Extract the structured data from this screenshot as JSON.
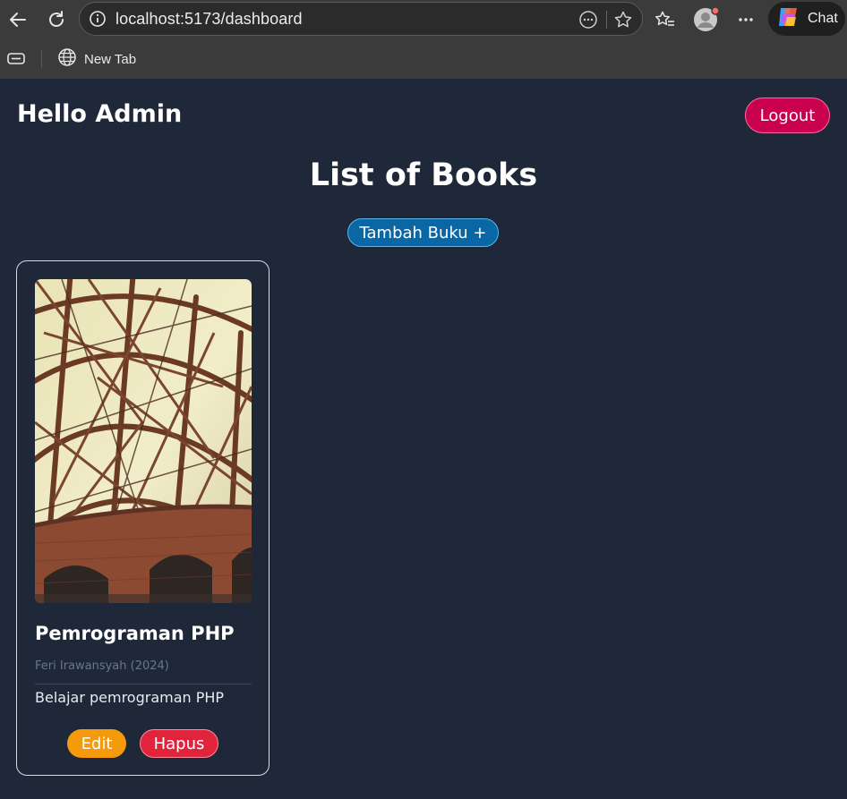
{
  "browser": {
    "url": "localhost:5173/dashboard",
    "chat_label": "Chat",
    "bookmarks": [
      {
        "label": "New Tab"
      }
    ]
  },
  "header": {
    "greeting": "Hello Admin",
    "logout_label": "Logout"
  },
  "main": {
    "title": "List of Books",
    "add_button_label": "Tambah Buku +",
    "books": [
      {
        "title": "Pemrograman PHP",
        "meta": "Feri Irawansyah (2024)",
        "description": "Belajar pemrograman PHP",
        "edit_label": "Edit",
        "delete_label": "Hapus"
      }
    ]
  },
  "colors": {
    "page_bg": "#1e2839",
    "logout": "#c8004e",
    "add": "#0b67a4",
    "edit": "#f59a0b",
    "delete": "#e2233c"
  }
}
